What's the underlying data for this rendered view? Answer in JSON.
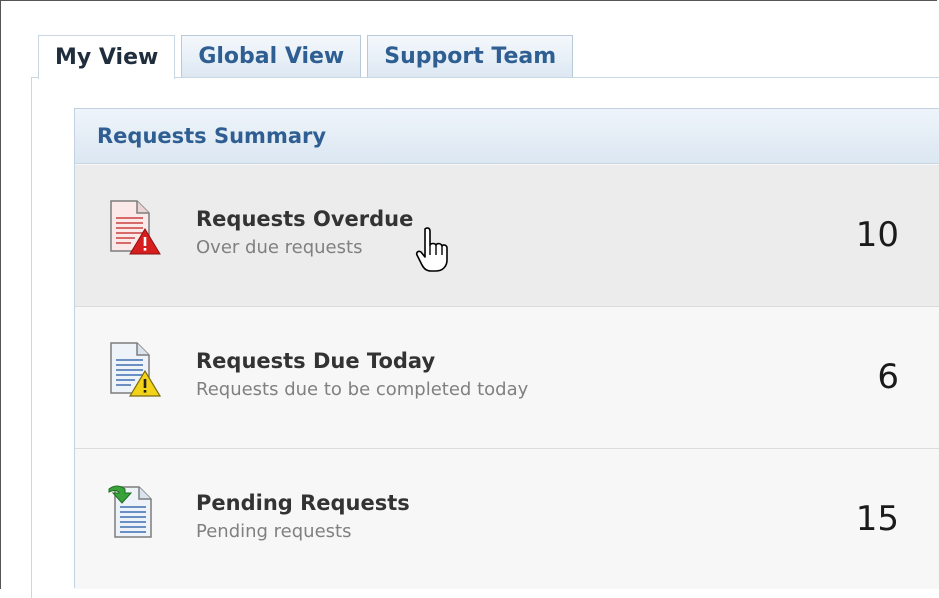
{
  "tabs": [
    {
      "label": "My View",
      "active": true
    },
    {
      "label": "Global View",
      "active": false
    },
    {
      "label": "Support Team",
      "active": false
    }
  ],
  "summary": {
    "title": "Requests Summary",
    "rows": [
      {
        "icon": "document-error-icon",
        "title": "Requests Overdue",
        "subtitle": "Over due requests",
        "count": "10"
      },
      {
        "icon": "document-warning-icon",
        "title": "Requests Due Today",
        "subtitle": "Requests due to be completed today",
        "count": "6"
      },
      {
        "icon": "document-pending-icon",
        "title": "Pending Requests",
        "subtitle": "Pending requests",
        "count": "15"
      }
    ]
  },
  "colors": {
    "tab_text": "#2f5f92",
    "header_text": "#2f5f92",
    "overdue_triangle": "#d61e1e",
    "warning_triangle": "#f3d21a",
    "pending_arrow": "#3aa23a"
  }
}
